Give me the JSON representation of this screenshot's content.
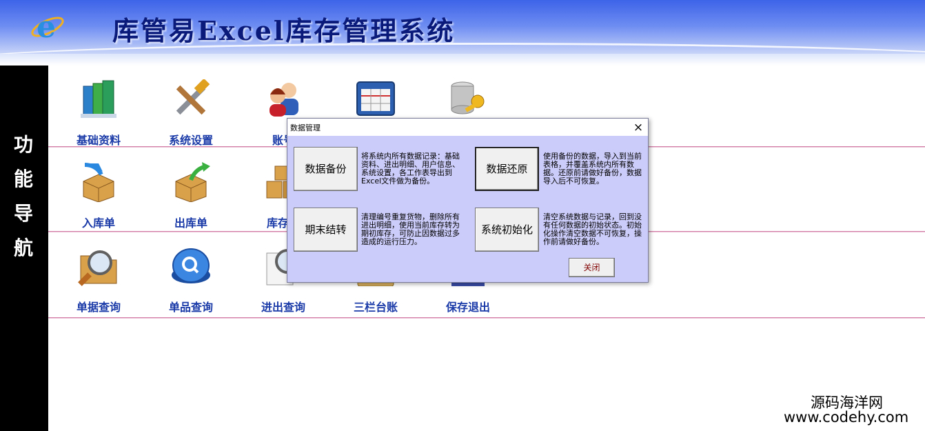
{
  "header": {
    "title": "库管易Excel库存管理系统"
  },
  "sidenav": {
    "label": "功能导航"
  },
  "tiles": {
    "row1": [
      {
        "label": "基础资料",
        "icon": "books-icon"
      },
      {
        "label": "系统设置",
        "icon": "tools-icon"
      },
      {
        "label": "账号",
        "icon": "users-icon"
      },
      {
        "label": "",
        "icon": "table-window-icon"
      },
      {
        "label": "",
        "icon": "database-key-icon"
      }
    ],
    "row2": [
      {
        "label": "入库单",
        "icon": "box-in-icon"
      },
      {
        "label": "出库单",
        "icon": "box-out-icon"
      },
      {
        "label": "库存汇",
        "icon": "boxes-icon"
      }
    ],
    "row3": [
      {
        "label": "单据查询",
        "icon": "folder-search-icon"
      },
      {
        "label": "单品查询",
        "icon": "search-button-icon"
      },
      {
        "label": "进出查询",
        "icon": "doc-search-icon"
      },
      {
        "label": "三栏台账",
        "icon": "ledger-icon"
      },
      {
        "label": "保存退出",
        "icon": "save-exit-icon"
      }
    ]
  },
  "dialog": {
    "title": "数据管理",
    "close_glyph": "×",
    "backup": {
      "label": "数据备份",
      "desc": "将系统内所有数据记录：基础资料、进出明细、用户信息、系统设置，各工作表导出到Excel文件做为备份。"
    },
    "restore": {
      "label": "数据还原",
      "desc": "使用备份的数据，导入到当前表格，并覆盖系统内所有数据。还原前请做好备份，数据导入后不可恢复。"
    },
    "period_end": {
      "label": "期末结转",
      "desc": "清理编号重复货物，删除所有进出明细，使用当前库存转为期初库存，可防止因数据过多造成的运行压力。"
    },
    "init": {
      "label": "系统初始化",
      "desc": "清空系统数据与记录，回到没有任何数据的初始状态。初始化操作清空数据不可恢复，操作前请做好备份。"
    },
    "close_label": "关闭"
  },
  "watermark": {
    "line1": "源码海洋网",
    "line2": "www.codehy.com"
  },
  "colors": {
    "accent": "#3d63e8",
    "dialog_bg": "#ccccfa",
    "tile_label": "#1a3aa8"
  }
}
